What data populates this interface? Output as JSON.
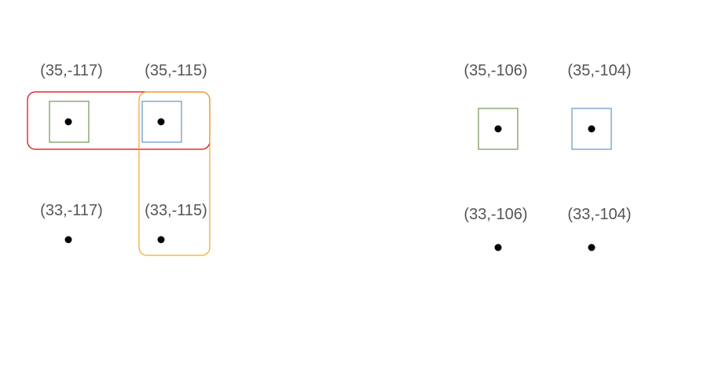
{
  "colors": {
    "label_text": "#555555",
    "point_fill": "#000000",
    "box_green": "#548235",
    "box_blue": "#4a7fb5",
    "group_red": "#e00000",
    "group_orange": "#f5a623"
  },
  "left_grid": {
    "labels": {
      "top_left": "(35,-117)",
      "top_right": "(35,-115)",
      "bottom_left": "(33,-117)",
      "bottom_right": "(33,-115)"
    }
  },
  "right_grid": {
    "labels": {
      "top_left": "(35,-106)",
      "top_right": "(35,-104)",
      "bottom_left": "(33,-106)",
      "bottom_right": "(33,-104)"
    }
  }
}
